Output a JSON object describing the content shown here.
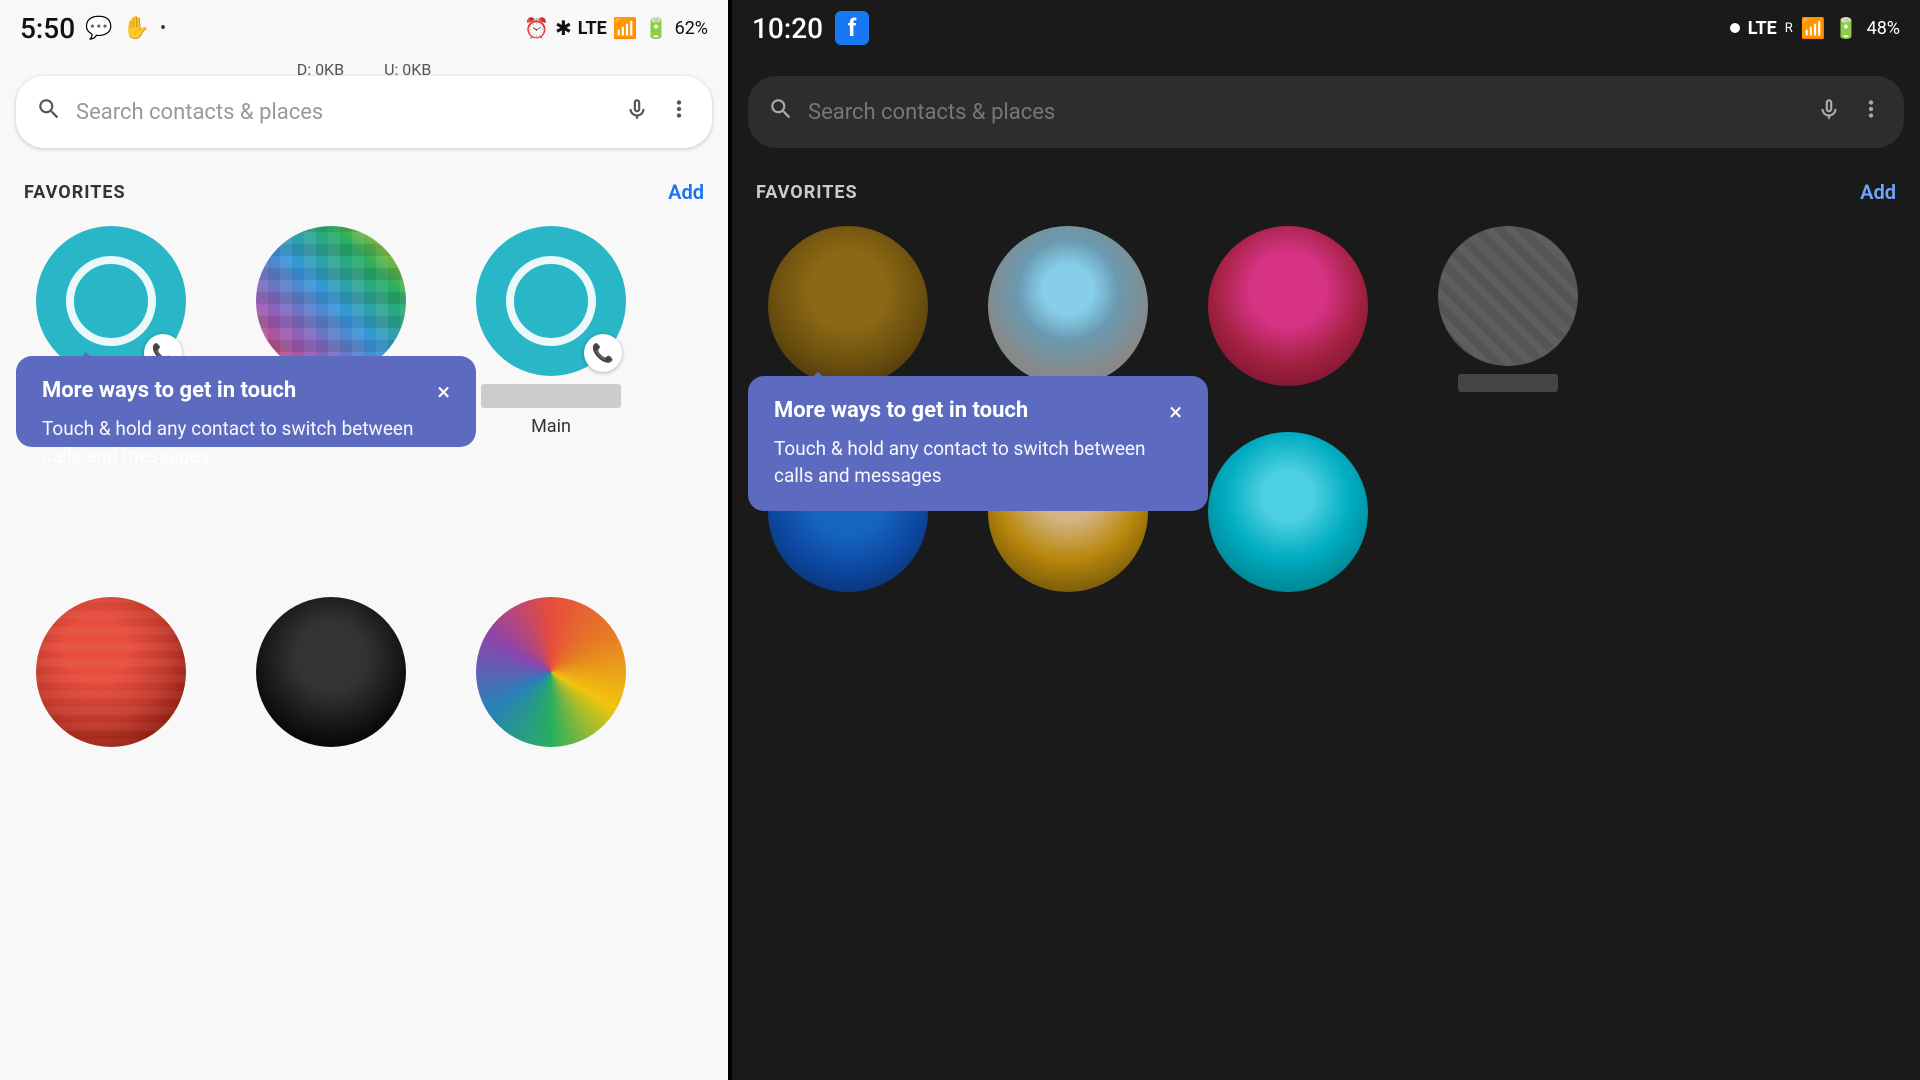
{
  "left": {
    "statusBar": {
      "time": "5:50",
      "icons": [
        "💬",
        "✋",
        "•"
      ],
      "rightIcons": [
        "⏰",
        "✱",
        "LTE",
        "📶",
        "🔋",
        "62%"
      ],
      "dataCounters": [
        "D: 0KB",
        "U: 0KB"
      ]
    },
    "search": {
      "placeholder": "Search contacts & places"
    },
    "favorites": {
      "title": "FAVORITES",
      "addLabel": "Add"
    },
    "tooltip": {
      "title": "More ways to get in touch",
      "body": "Touch & hold any contact to switch between calls and messages",
      "closeLabel": "×"
    },
    "contacts": [
      {
        "type": "teal-avatar",
        "name": "",
        "hasBadge": true
      },
      {
        "type": "pixel-1",
        "name": "",
        "hasBadge": false
      },
      {
        "type": "teal-avatar",
        "name": "Main",
        "hasBadge": true
      }
    ],
    "bottomContacts": [
      {
        "type": "red-pixel",
        "name": ""
      },
      {
        "type": "dark-pixel",
        "name": ""
      },
      {
        "type": "colorful-pixel",
        "name": ""
      }
    ]
  },
  "right": {
    "statusBar": {
      "time": "10:20",
      "fbLabel": "f",
      "dot": "•",
      "rightIcons": [
        "LTE",
        "R",
        "📶",
        "🔋",
        "48%"
      ]
    },
    "search": {
      "placeholder": "Search contacts & places"
    },
    "favorites": {
      "title": "FAVORITES",
      "addLabel": "Add"
    },
    "tooltip": {
      "title": "More ways to get in touch",
      "body": "Touch & hold any contact to switch between calls and messages",
      "closeLabel": "×"
    },
    "contacts": [
      {
        "type": "brown-avatar",
        "name": ""
      },
      {
        "type": "blue-hat-avatar",
        "name": ""
      },
      {
        "type": "pink-avatar",
        "name": ""
      },
      {
        "type": "partial-avatar",
        "name": ""
      }
    ],
    "bottomContacts": [
      {
        "type": "dark-blue-avatar",
        "name": ""
      },
      {
        "type": "tan-avatar",
        "name": ""
      },
      {
        "type": "cyan-avatar",
        "name": ""
      }
    ]
  }
}
